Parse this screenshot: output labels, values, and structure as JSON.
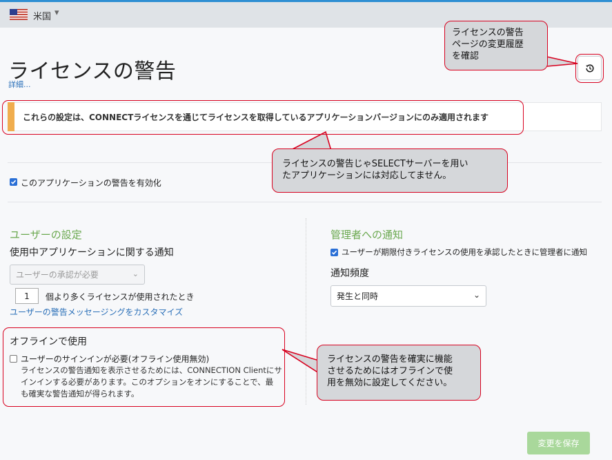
{
  "header": {
    "country": "米国"
  },
  "page": {
    "title": "ライセンスの警告",
    "details_link": "詳細..."
  },
  "alert": {
    "text": "これらの設定は、CONNECTライセンスを通じてライセンスを取得しているアプリケーションバージョンにのみ適用されます"
  },
  "enable": {
    "label": "このアプリケーションの警告を有効化",
    "checked": true
  },
  "user_settings": {
    "heading": "ユーザーの設定",
    "subheading": "使用中アプリケーションに関する通知",
    "select_value": "ユーザーの承認が必要",
    "count_value": "1",
    "count_label": "個より多くライセンスが使用されたとき",
    "customize_link": "ユーザーの警告メッセージングをカスタマイズ"
  },
  "offline": {
    "heading": "オフラインで使用",
    "checkbox_label": "ユーザーのサインインが必要(オフライン使用無効)",
    "description_lines": [
      "ライセンスの警告通知を表示させるためには、CONNECTION Clientにサ",
      "インインする必要があります。このオプションをオンにすることで、最",
      "も確実な警告通知が得られます。"
    ],
    "checked": false
  },
  "admin": {
    "heading": "管理者への通知",
    "checkbox_label": "ユーザーが期限付きライセンスの使用を承認したときに管理者に通知",
    "checked": true,
    "frequency_label": "通知頻度",
    "frequency_value": "発生と同時"
  },
  "footer": {
    "save_label": "変更を保存"
  },
  "callouts": {
    "history": [
      "ライセンスの警告",
      "ページの変更履歴",
      "を確認"
    ],
    "select_server": [
      "ライセンスの警告じゃSELECTサーバーを用い",
      "たアプリケーションには対応してません。"
    ],
    "offline_note": [
      "ライセンスの警告を確実に機能",
      "させるためにはオフラインで使",
      "用を無効に設定してください。"
    ]
  },
  "colors": {
    "accent_green": "#6aa84f",
    "alert_orange": "#f0ad4e",
    "callout_red": "#d8001e",
    "link_blue": "#2a6fb8"
  }
}
